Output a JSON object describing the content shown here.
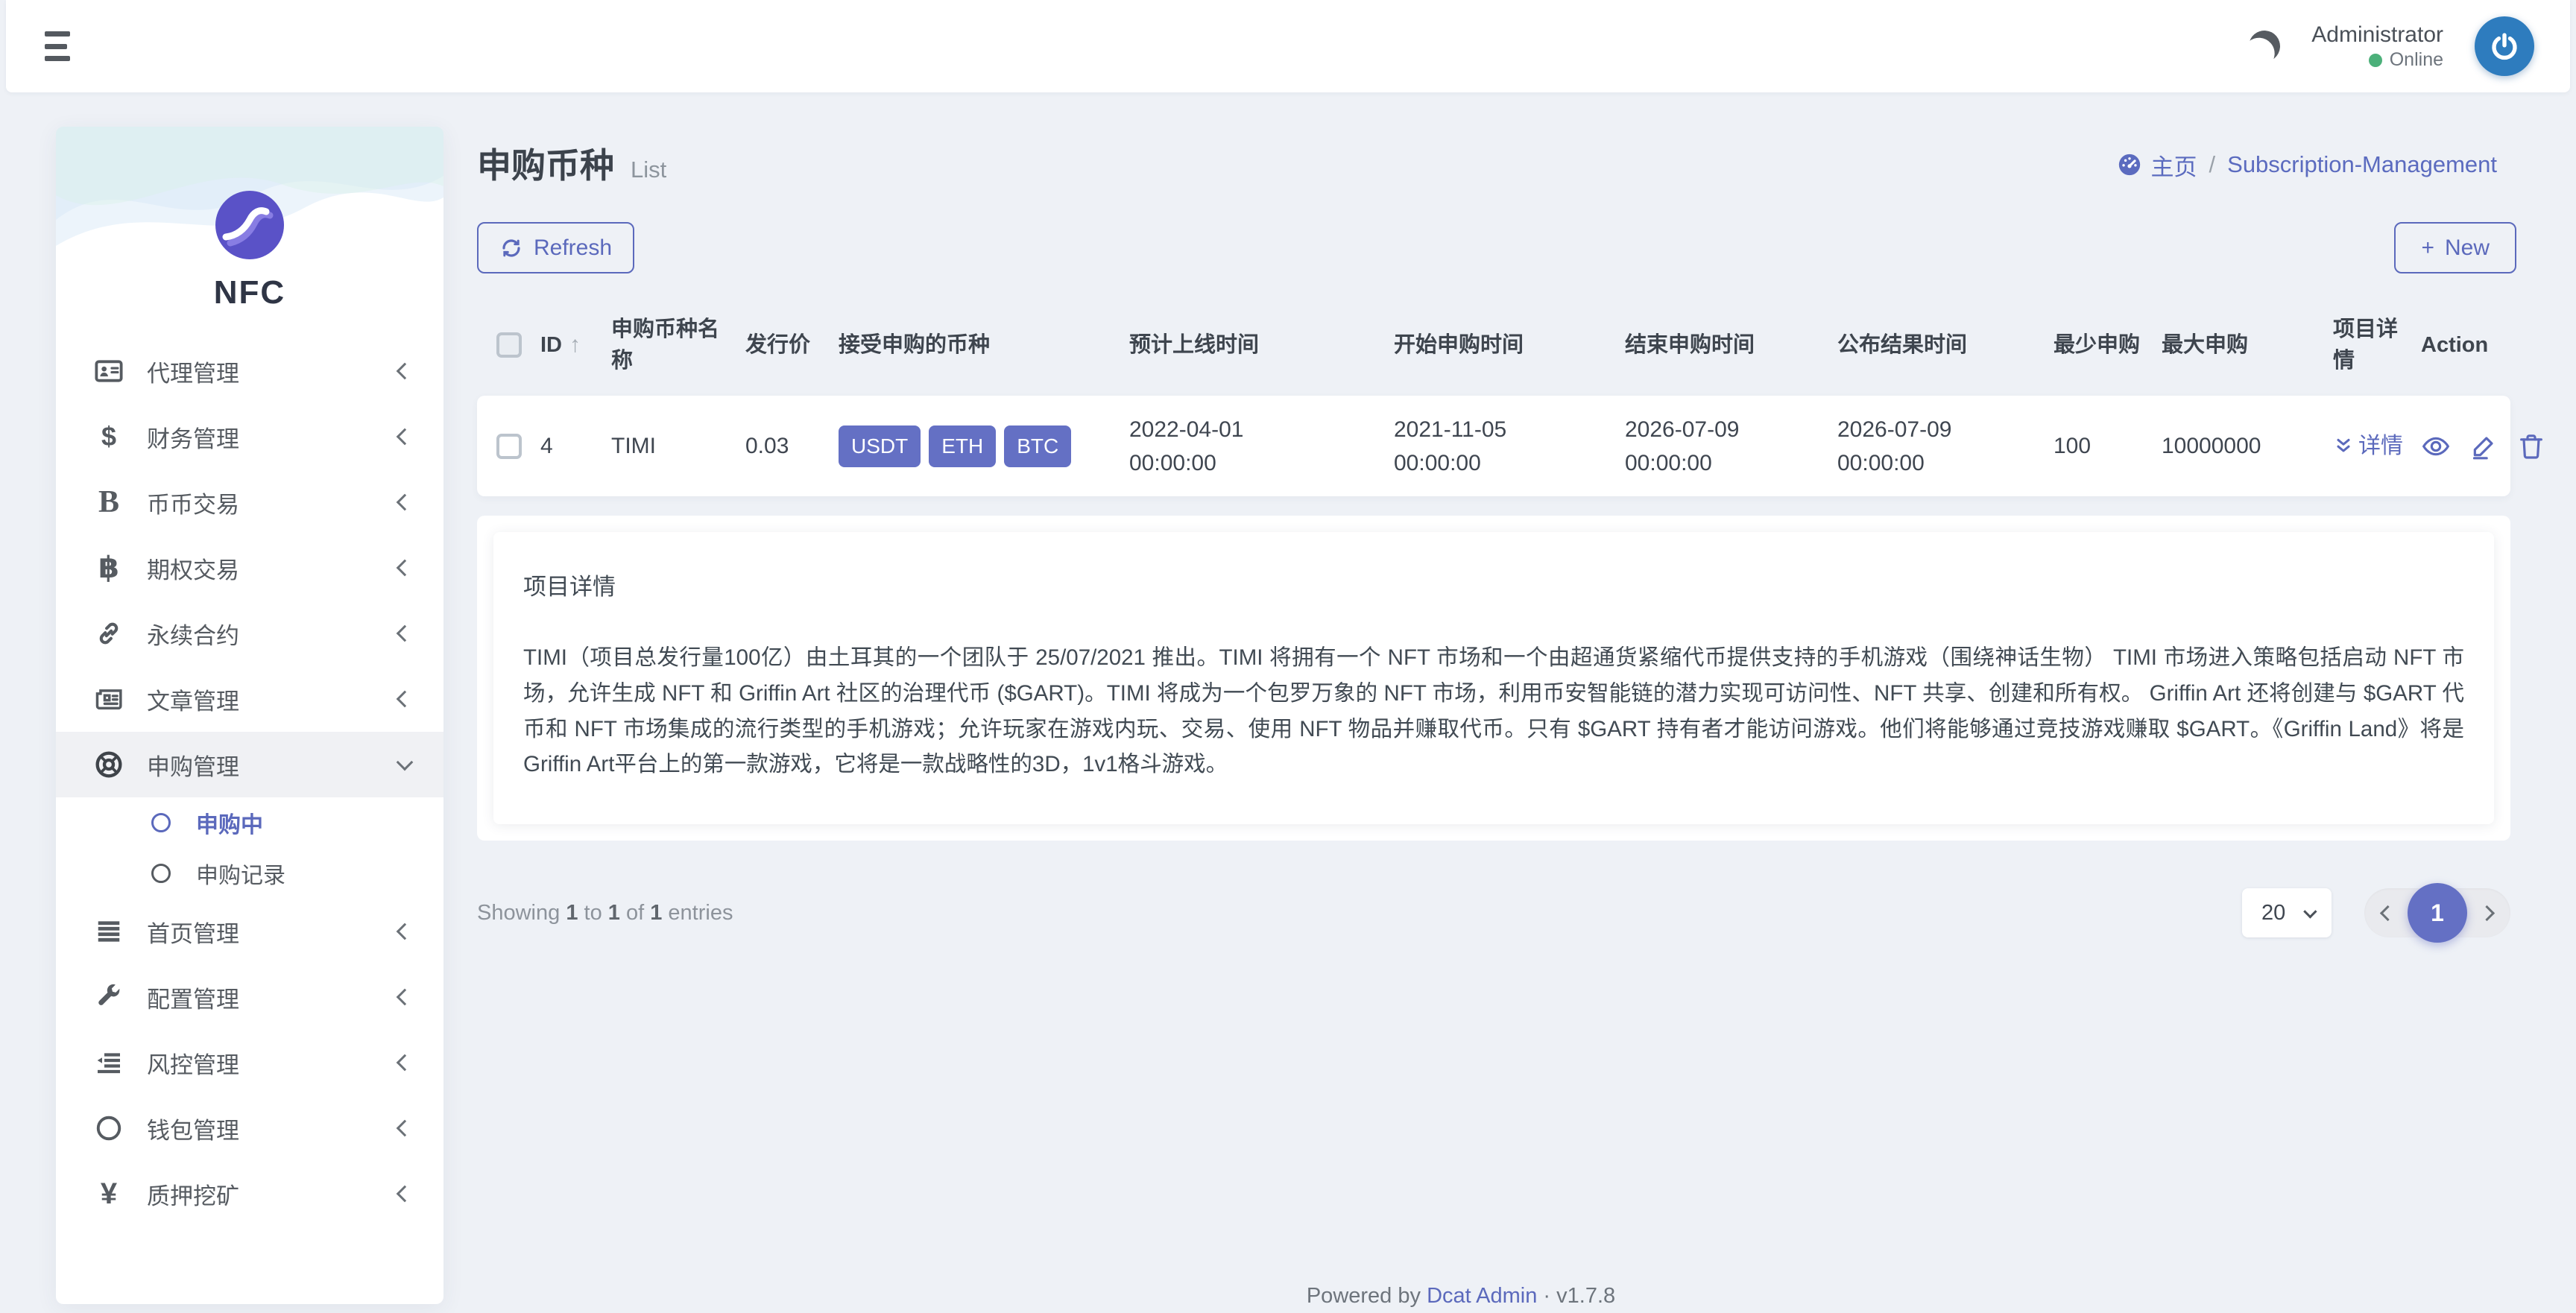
{
  "colors": {
    "primary": "#5b69bc",
    "badge": "#6470c4",
    "online": "#4cb07a",
    "avatar_bg": "#2e7cbe",
    "page_bg": "#eef1f6"
  },
  "topbar": {
    "user": {
      "name": "Administrator",
      "status": "Online"
    }
  },
  "sidebar": {
    "logo_text": "NFC",
    "items": [
      {
        "label": "代理管理",
        "icon": "id-card"
      },
      {
        "label": "财务管理",
        "icon": "dollar"
      },
      {
        "label": "币币交易",
        "icon": "letter-b"
      },
      {
        "label": "期权交易",
        "icon": "bitcoin"
      },
      {
        "label": "永续合约",
        "icon": "chain-link"
      },
      {
        "label": "文章管理",
        "icon": "newspaper"
      },
      {
        "label": "申购管理",
        "icon": "life-ring",
        "expanded": true
      },
      {
        "label": "首页管理",
        "icon": "bars"
      },
      {
        "label": "配置管理",
        "icon": "wrench"
      },
      {
        "label": "风控管理",
        "icon": "outdent"
      },
      {
        "label": "钱包管理",
        "icon": "circle"
      },
      {
        "label": "质押挖矿",
        "icon": "yen"
      }
    ],
    "submenu": [
      {
        "label": "申购中",
        "active": true
      },
      {
        "label": "申购记录",
        "active": false
      }
    ],
    "icon_glyphs": {
      "dollar": "$",
      "letter_b": "B",
      "bitcoin": "฿",
      "yen": "¥"
    }
  },
  "page": {
    "title": "申购币种",
    "subtitle": "List",
    "breadcrumb": {
      "home": "主页",
      "separator": "/",
      "current": "Subscription-Management"
    }
  },
  "toolbar": {
    "refresh_label": "Refresh",
    "new_label": "New",
    "plus": "+"
  },
  "table": {
    "headers": {
      "id": "ID",
      "name": "申购币种名称",
      "price": "发行价",
      "accepted": "接受申购的币种",
      "expected_online": "预计上线时间",
      "start_time": "开始申购时间",
      "end_time": "结束申购时间",
      "publish_time": "公布结果时间",
      "min": "最少申购",
      "max": "最大申购",
      "detail": "项目详情",
      "action": "Action"
    },
    "row": {
      "id": "4",
      "name": "TIMI",
      "price": "0.03",
      "accepted": [
        "USDT",
        "ETH",
        "BTC"
      ],
      "expected_online": {
        "date": "2022-04-01",
        "time": "00:00:00"
      },
      "start_time": {
        "date": "2021-11-05",
        "time": "00:00:00"
      },
      "end_time": {
        "date": "2026-07-09",
        "time": "00:00:00"
      },
      "publish_time": {
        "date": "2026-07-09",
        "time": "00:00:00"
      },
      "min": "100",
      "max": "10000000",
      "detail_link": "详情"
    }
  },
  "detail_panel": {
    "title": "项目详情",
    "body": "TIMI（项目总发行量100亿）由土耳其的一个团队于 25/07/2021 推出。TIMI 将拥有一个 NFT 市场和一个由超通货紧缩代币提供支持的手机游戏（围绕神话生物） TIMI 市场进入策略包括启动 NFT 市场，允许生成 NFT 和 Griffin Art 社区的治理代币 ($GART)。TIMI 将成为一个包罗万象的 NFT 市场，利用币安智能链的潜力实现可访问性、NFT 共享、创建和所有权。 Griffin Art 还将创建与 $GART 代币和 NFT 市场集成的流行类型的手机游戏；允许玩家在游戏内玩、交易、使用 NFT 物品并赚取代币。只有 $GART 持有者才能访问游戏。他们将能够通过竞技游戏赚取 $GART。《Griffin Land》将是Griffin Art平台上的第一款游戏，它将是一款战略性的3D，1v1格斗游戏。"
  },
  "pagination": {
    "showing_prefix": "Showing",
    "from": "1",
    "to_word": "to",
    "to": "1",
    "of_word": "of",
    "total": "1",
    "entries_word": "entries",
    "per_page": "20",
    "current_page": "1"
  },
  "footer": {
    "powered_by": "Powered by",
    "brand": "Dcat Admin",
    "dot": "·",
    "version": "v1.7.8"
  }
}
